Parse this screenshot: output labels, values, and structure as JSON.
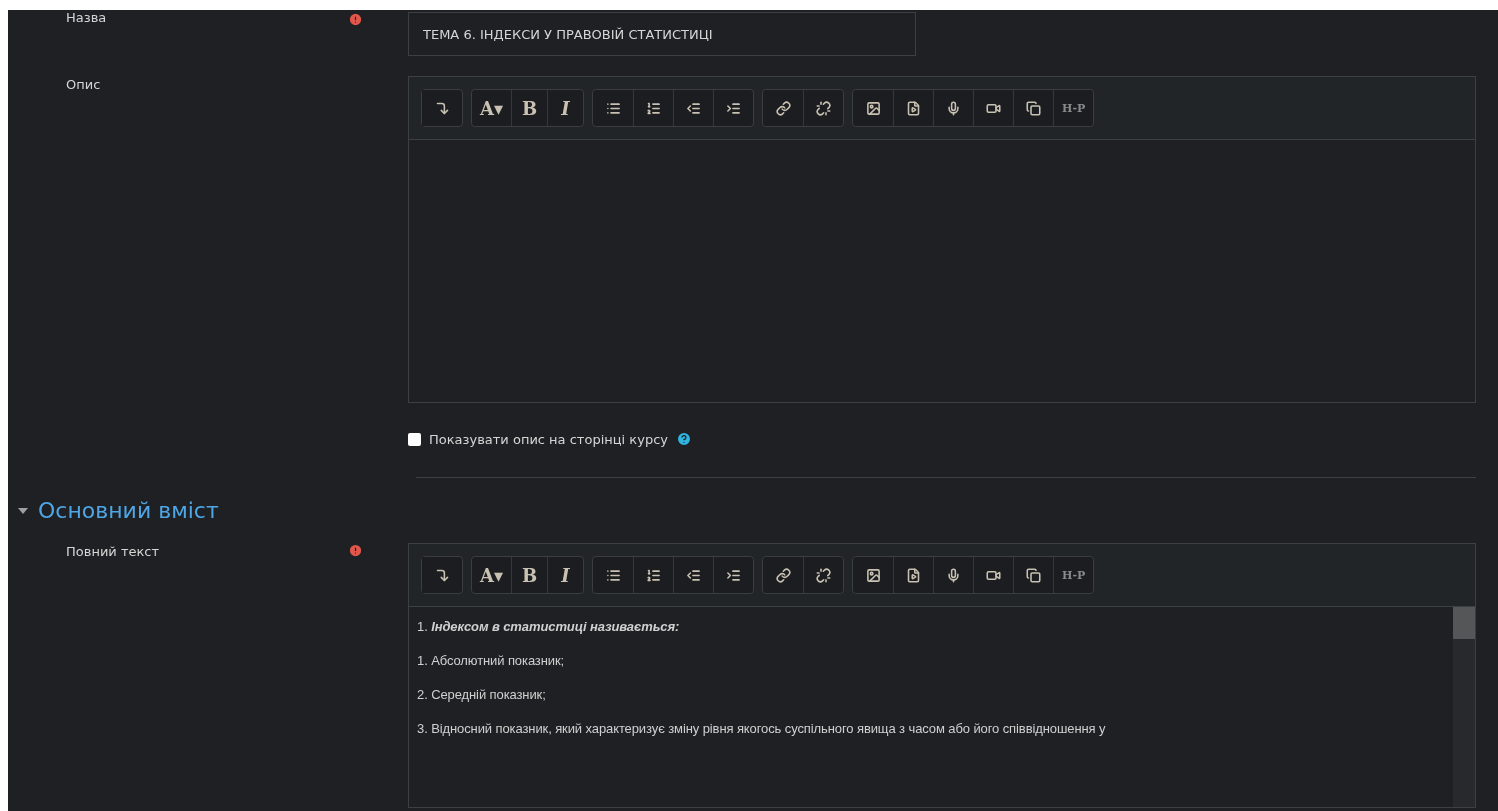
{
  "fields": [
    {
      "kind": "text",
      "label": "Назва",
      "required": true,
      "value": "ТЕМА 6. ІНДЕКСИ У ПРАВОВІЙ СТАТИСТИЦІ"
    },
    {
      "kind": "editor",
      "label": "Опис",
      "required": false,
      "toolbar": [
        [
          {
            "kind": "icon"
          }
        ],
        [
          {
            "kind": "text",
            "label": "A▾"
          },
          {
            "kind": "text",
            "label": "B"
          },
          {
            "kind": "text",
            "label": "I"
          }
        ],
        [
          {
            "kind": "icon"
          },
          {
            "kind": "icon"
          },
          {
            "kind": "icon"
          },
          {
            "kind": "icon"
          }
        ],
        [
          {
            "kind": "icon"
          },
          {
            "kind": "icon"
          }
        ],
        [
          {
            "kind": "icon"
          },
          {
            "kind": "icon"
          },
          {
            "kind": "icon"
          },
          {
            "kind": "icon"
          },
          {
            "kind": "icon"
          },
          {
            "kind": "text",
            "label": "H-P"
          }
        ]
      ]
    },
    {
      "kind": "checkbox",
      "label": "Показувати опис на сторінці курсу",
      "checked": false
    }
  ],
  "section": {
    "title": "Основний вміст",
    "expanded": true,
    "fields": [
      {
        "kind": "editor",
        "label": "Повний текст",
        "required": true,
        "toolbar": [
          [
            {
              "kind": "icon"
            }
          ],
          [
            {
              "kind": "text",
              "label": "A▾"
            },
            {
              "kind": "text",
              "label": "B"
            },
            {
              "kind": "text",
              "label": "I"
            }
          ],
          [
            {
              "kind": "icon"
            },
            {
              "kind": "icon"
            },
            {
              "kind": "icon"
            },
            {
              "kind": "icon"
            }
          ],
          [
            {
              "kind": "icon"
            },
            {
              "kind": "icon"
            }
          ],
          [
            {
              "kind": "icon"
            },
            {
              "kind": "icon"
            },
            {
              "kind": "icon"
            },
            {
              "kind": "icon"
            },
            {
              "kind": "icon"
            },
            {
              "kind": "text",
              "label": "H-P"
            }
          ]
        ],
        "lines": [
          "1. **Індексом в статистиці називається:**",
          "1. Абсолютний показник;",
          "2. Середній показник;",
          "3. Відносний показник, який характеризує зміну рівня якогось суспільного явища з часом або його співвідношення у"
        ]
      }
    ]
  }
}
